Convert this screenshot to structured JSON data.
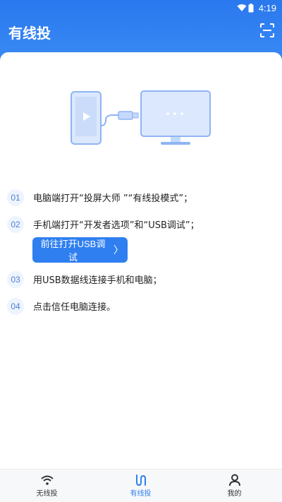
{
  "status_bar": {
    "time": "4:19"
  },
  "header": {
    "title": "有线投"
  },
  "steps": [
    {
      "num": "01",
      "text": "电脑端打开“投屏大师 ”“有线投模式”；"
    },
    {
      "num": "02",
      "text": "手机端打开“开发者选项”和“USB调试”；"
    },
    {
      "num": "03",
      "text": "用USB数据线连接手机和电脑；"
    },
    {
      "num": "04",
      "text": "点击信任电脑连接。"
    }
  ],
  "usb_button": {
    "label": "前往打开USB调试",
    "chevron": "〉"
  },
  "tabbar": {
    "items": [
      {
        "label": "无线投",
        "icon": "wifi-icon",
        "active": false
      },
      {
        "label": "有线投",
        "icon": "cable-icon",
        "active": true
      },
      {
        "label": "我的",
        "icon": "person-icon",
        "active": false
      }
    ]
  },
  "colors": {
    "accent": "#2f7ff0",
    "header": "#2a78ee"
  }
}
